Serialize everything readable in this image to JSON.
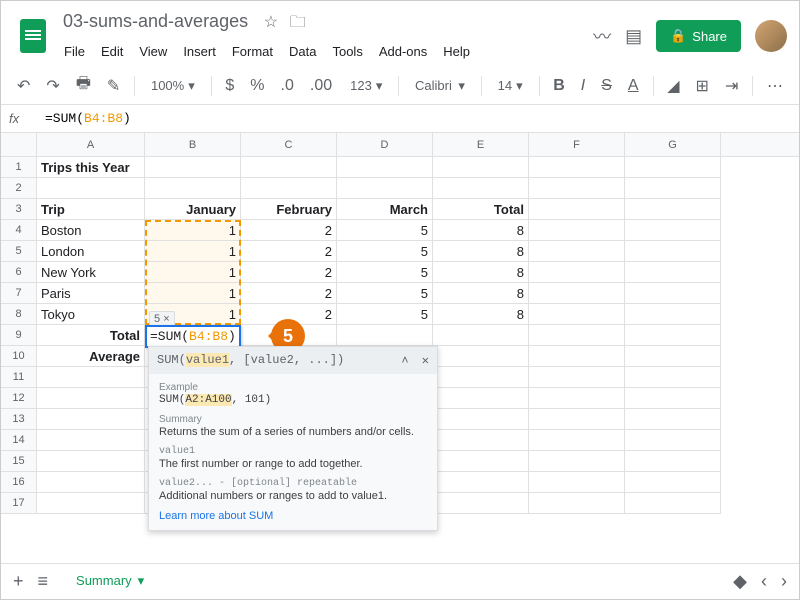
{
  "doc": {
    "title": "03-sums-and-averages"
  },
  "menu": {
    "file": "File",
    "edit": "Edit",
    "view": "View",
    "insert": "Insert",
    "format": "Format",
    "data": "Data",
    "tools": "Tools",
    "addons": "Add-ons",
    "help": "Help"
  },
  "share": "Share",
  "toolbar": {
    "zoom": "100%",
    "numfmt": "123",
    "font": "Calibri",
    "size": "14"
  },
  "fx": {
    "label": "fx",
    "prefix": "=SUM(",
    "range": "B4:B8",
    "suffix": ")"
  },
  "cols": {
    "A": "A",
    "B": "B",
    "C": "C",
    "D": "D",
    "E": "E",
    "F": "F",
    "G": "G"
  },
  "rows": [
    "1",
    "2",
    "3",
    "4",
    "5",
    "6",
    "7",
    "8",
    "9",
    "10",
    "11",
    "12",
    "13",
    "14",
    "15",
    "16",
    "17"
  ],
  "sheet": {
    "title": "Trips this Year",
    "hdr": {
      "trip": "Trip",
      "jan": "January",
      "feb": "February",
      "mar": "March",
      "tot": "Total"
    },
    "trips": [
      {
        "name": "Boston",
        "jan": "1",
        "feb": "2",
        "mar": "5",
        "tot": "8"
      },
      {
        "name": "London",
        "jan": "1",
        "feb": "2",
        "mar": "5",
        "tot": "8"
      },
      {
        "name": "New York",
        "jan": "1",
        "feb": "2",
        "mar": "5",
        "tot": "8"
      },
      {
        "name": "Paris",
        "jan": "1",
        "feb": "2",
        "mar": "5",
        "tot": "8"
      },
      {
        "name": "Tokyo",
        "jan": "1",
        "feb": "2",
        "mar": "5",
        "tot": "8"
      }
    ],
    "total_label": "Total",
    "avg_label": "Average"
  },
  "edit": {
    "hint": "5",
    "hint_x": "×",
    "formula_prefix": "=SUM(",
    "formula_range": "B4:B8",
    "formula_suffix": ")"
  },
  "callout": "5",
  "tooltip": {
    "sig_fn": "SUM(",
    "sig_a1": "value1",
    "sig_rest": ", [value2, ...])",
    "ex_label": "Example",
    "ex_code_pre": "SUM(",
    "ex_code_rng": "A2:A100",
    "ex_code_post": ", 101)",
    "sum_label": "Summary",
    "sum_text": "Returns the sum of a series of numbers and/or cells.",
    "v1_label": "value1",
    "v1_text": "The first number or range to add together.",
    "v2_label": "value2... - [optional] repeatable",
    "v2_text": "Additional numbers or ranges to add to value1.",
    "link": "Learn more about SUM"
  },
  "tab": {
    "name": "Summary"
  }
}
